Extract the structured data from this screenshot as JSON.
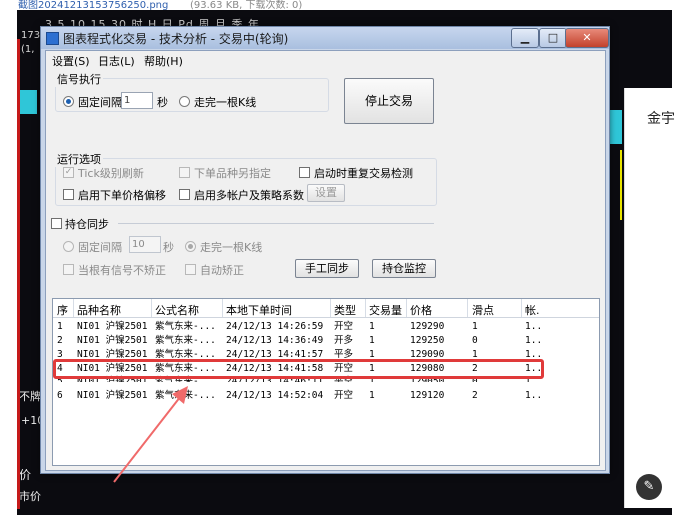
{
  "top_strip": {
    "filename": "截图20241213153756250.png",
    "meta": "(93.63 KB, 下载次数: 0)"
  },
  "background": {
    "timeframes": "3   5  10  15  30  时  H   日  Pd  周  月  季  年",
    "numbers": [
      "173",
      "(1,"
    ],
    "left_labels": [
      "不牌",
      "+10",
      "价",
      "市价"
    ],
    "right_edge_labels": [
      "金宇"
    ]
  },
  "window": {
    "title": "图表程式化交易 - 技术分析 - 交易中(轮询)",
    "buttons": {
      "minimize": "▁",
      "maximize": "□",
      "close": "✕"
    },
    "menu": [
      "设置(S)",
      "日志(L)",
      "帮助(H)"
    ],
    "signal": {
      "group_label": "信号执行",
      "fixed_interval_label": "固定间隔",
      "interval_value": "1",
      "seconds_label": "秒",
      "bar_close_label": "走完一根K线",
      "stop_button": "停止交易"
    },
    "run_options": {
      "group_label": "运行选项",
      "tick_refresh": "Tick级别刷新",
      "single_instrument": "下单品种另指定",
      "restart_check": "启动时重复交易检测",
      "price_offset": "启用下单价格偏移",
      "multi_account": "启用多帐户及策略系数",
      "settings_button": "设置"
    },
    "position_sync": {
      "group_label": "持仓同步",
      "fixed_interval_label": "固定间隔",
      "interval_value": "10",
      "seconds_label": "秒",
      "bar_close_label": "走完一根K线",
      "no_correct_label": "当根有信号不矫正",
      "auto_correct_label": "自动矫正",
      "manual_sync_button": "手工同步",
      "monitor_button": "持仓监控"
    },
    "table": {
      "columns": [
        "序",
        "品种名称",
        "公式名称",
        "本地下单时间",
        "类型",
        "交易量",
        "价格",
        "滑点",
        "帐."
      ],
      "rows": [
        [
          "1",
          "NI01 沪镍2501",
          "紫气东来-...",
          "24/12/13 14:26:59",
          "开空",
          "1",
          "129290",
          "1",
          "1.."
        ],
        [
          "2",
          "NI01 沪镍2501",
          "紫气东来-...",
          "24/12/13 14:36:49",
          "开多",
          "1",
          "129250",
          "0",
          "1.."
        ],
        [
          "3",
          "NI01 沪镍2501",
          "紫气东来-...",
          "24/12/13 14:41:57",
          "平多",
          "1",
          "129090",
          "1",
          "1.."
        ],
        [
          "4",
          "NI01 沪镍2501",
          "紫气东来-...",
          "24/12/13 14:41:58",
          "开空",
          "1",
          "129080",
          "2",
          "1.."
        ],
        [
          "5",
          "NI01 沪镍2501",
          "紫气东来-...",
          "24/12/13 14:46:11",
          "平空",
          "1",
          "129050",
          "0",
          "1.."
        ],
        [
          "6",
          "NI01 沪镍2501",
          "紫气东来-...",
          "24/12/13 14:52:04",
          "开空",
          "1",
          "129120",
          "2",
          "1.."
        ]
      ]
    }
  },
  "colors": {
    "highlight": "#e03a3a",
    "arrow": "#f06a6a",
    "titlebar": "#b8cbe6"
  }
}
